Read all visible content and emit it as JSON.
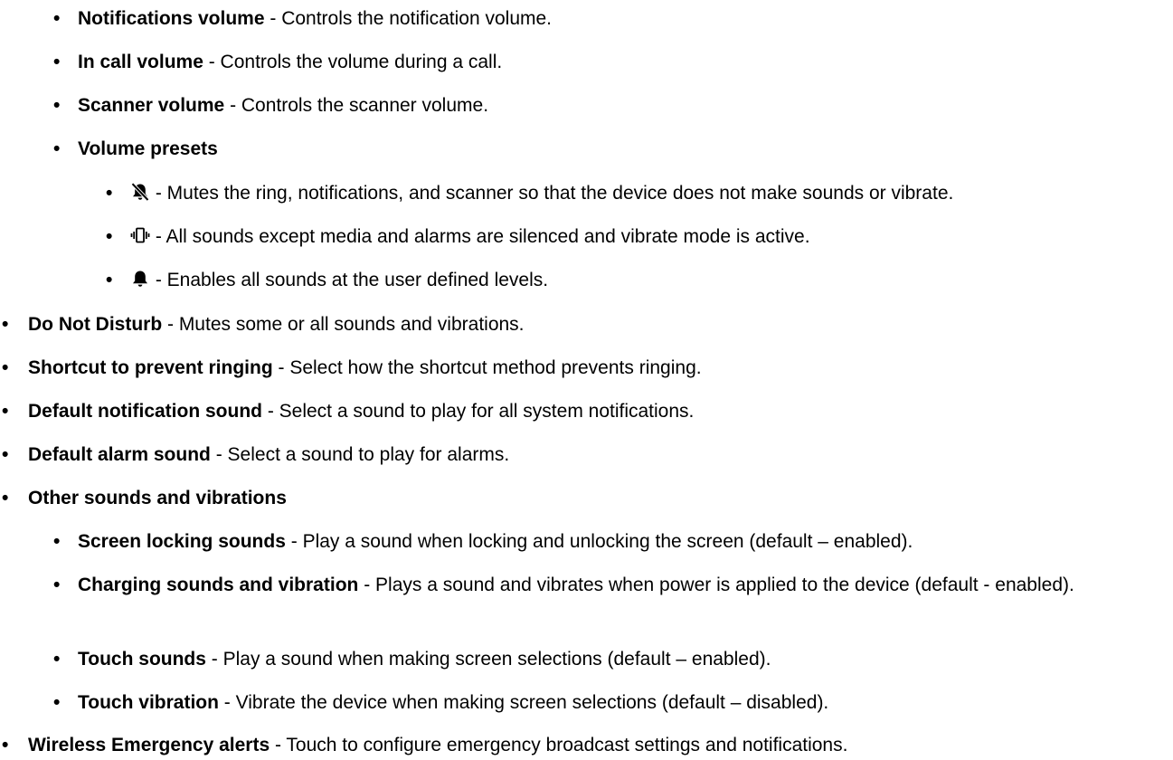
{
  "bullet": "•",
  "sound_settings": {
    "notifications_volume": {
      "term": "Notifications volume",
      "desc": " - Controls the notification volume."
    },
    "in_call_volume": {
      "term": "In call volume",
      "desc": " - Controls the volume during a call."
    },
    "scanner_volume": {
      "term": "Scanner volume",
      "desc": " - Controls the scanner volume."
    },
    "volume_presets": {
      "term": "Volume presets",
      "mute": {
        "icon": "bell-off-icon",
        "desc": " - Mutes the ring, notifications, and scanner so that the device does not make sounds or vibrate."
      },
      "vibrate": {
        "icon": "vibrate-icon",
        "desc": " - All sounds except media and alarms are silenced and vibrate mode is active."
      },
      "sound": {
        "icon": "bell-icon",
        "desc": " - Enables all sounds at the user defined levels."
      }
    },
    "do_not_disturb": {
      "term": "Do Not Disturb",
      "desc": " - Mutes some or all sounds and vibrations."
    },
    "shortcut_prevent_ringing": {
      "term": "Shortcut to prevent ringing",
      "desc": " - Select how the shortcut method prevents ringing."
    },
    "default_notification_sound": {
      "term": "Default notification sound",
      "desc": " - Select a sound to play for all system notifications."
    },
    "default_alarm_sound": {
      "term": "Default alarm sound",
      "desc": " - Select a sound to play for alarms."
    },
    "other_sounds": {
      "term": "Other sounds and vibrations",
      "screen_locking": {
        "term": "Screen locking sounds",
        "desc": " - Play a sound when locking and unlocking the screen (default – enabled)."
      },
      "charging": {
        "term": "Charging sounds and vibration",
        "desc": " - Plays a sound and vibrates when power is applied to the device (default - enabled)."
      },
      "touch_sounds": {
        "term": "Touch sounds",
        "desc": " - Play a sound when making screen selections (default – enabled)."
      },
      "touch_vibration": {
        "term": "Touch vibration",
        "desc": " - Vibrate the device when making screen selections (default – disabled)."
      }
    },
    "wireless_emergency_alerts": {
      "term": "Wireless Emergency alerts",
      "desc": " - Touch to configure emergency broadcast settings and notifications."
    }
  }
}
